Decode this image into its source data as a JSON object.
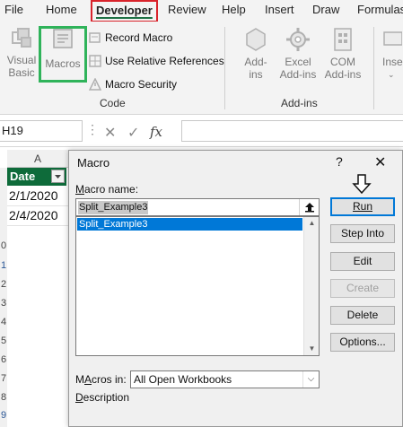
{
  "ribbon_tabs": [
    "File",
    "Home",
    "Developer",
    "Review",
    "Help",
    "Insert",
    "Draw",
    "Formulas"
  ],
  "code_group": {
    "label": "Code",
    "visual_basic": [
      "Visual",
      "Basic"
    ],
    "macros": "Macros",
    "record_macro": "Record Macro",
    "relative_refs": "Use Relative References",
    "macro_security": "Macro Security"
  },
  "addins_group": {
    "label": "Add-ins",
    "addins": [
      "Add-",
      "ins"
    ],
    "excel_addins": [
      "Excel",
      "Add-ins"
    ],
    "com_addins": [
      "COM",
      "Add-ins"
    ],
    "insert": "Inse"
  },
  "formula_bar": {
    "name_box": "H19",
    "fx": "fx"
  },
  "sheet": {
    "column_header": "A",
    "header_cell": "Date",
    "cells": [
      "2/1/2020",
      "2/4/2020"
    ],
    "row_numbers": [
      "0",
      "1",
      "2",
      "3",
      "4",
      "5",
      "6",
      "7",
      "8",
      "9"
    ]
  },
  "macro_dialog": {
    "title": "Macro",
    "help": "?",
    "close": "✕",
    "macro_name_label_u": "M",
    "macro_name_label_rest": "acro name:",
    "macro_name_value": "Split_Example3",
    "macros": [
      "Split_Example3"
    ],
    "macros_in_label_u": "A",
    "macros_in_label_pre": "M",
    "macros_in_label_rest": "cros in:",
    "macros_in_value": "All Open Workbooks",
    "description_label_pre": "D",
    "description_label_rest": "escription",
    "buttons": {
      "run": "Run",
      "step_into": "Step Into",
      "edit": "Edit",
      "create": "Create",
      "delete": "Delete",
      "options": "Options..."
    }
  },
  "colors": {
    "developer_highlight": "#d9232b",
    "macros_highlight": "#2fb35a",
    "header_fill": "#0e6b3a",
    "selection": "#0078d7"
  }
}
